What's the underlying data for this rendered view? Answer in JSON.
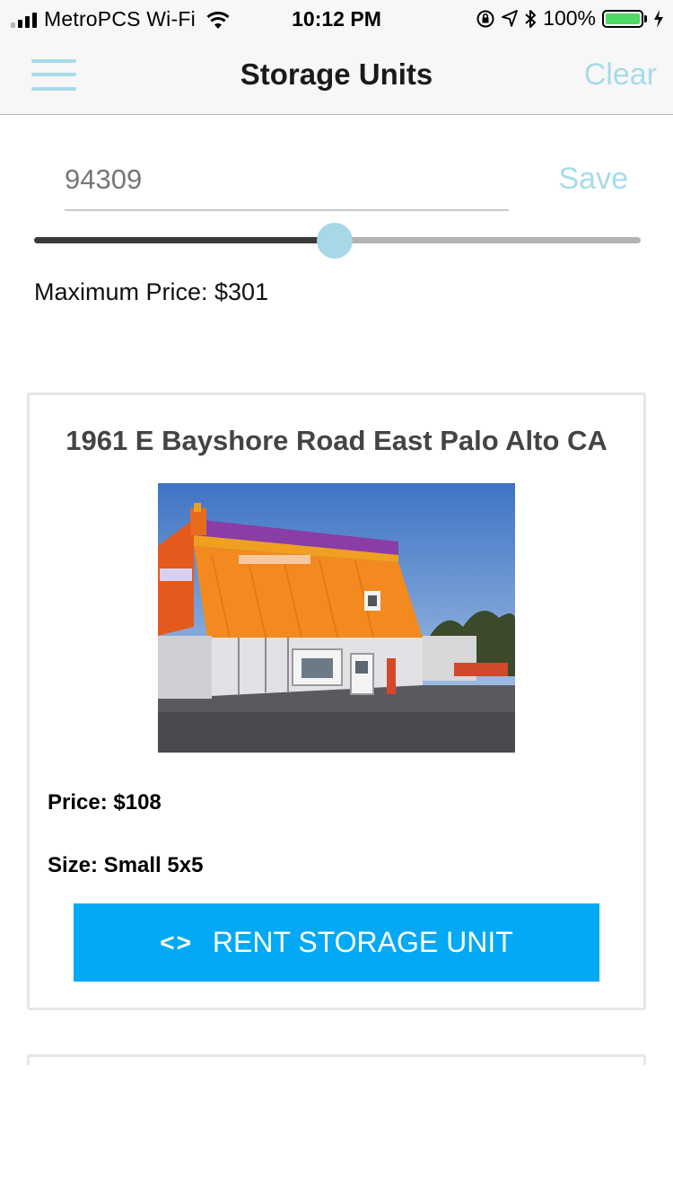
{
  "status_bar": {
    "carrier": "MetroPCS Wi-Fi",
    "time": "10:12 PM",
    "battery_percent": "100%",
    "signal_bars": 4,
    "signal_bars_active": 3,
    "icons": [
      "wifi-icon",
      "orientation-lock-icon",
      "location-arrow-icon",
      "bluetooth-icon",
      "battery-icon",
      "charging-bolt-icon"
    ]
  },
  "nav": {
    "title": "Storage Units",
    "clear_label": "Clear",
    "menu_icon": "hamburger-menu-icon"
  },
  "search": {
    "zip_value": "94309",
    "save_label": "Save"
  },
  "price_slider": {
    "fraction": 0.496,
    "max_price_text": "Maximum Price: $301"
  },
  "listings": [
    {
      "address": "1961 E Bayshore Road East Palo Alto CA",
      "price_text": "Price: $108",
      "size_text": "Size: Small 5x5",
      "rent_label": "RENT STORAGE UNIT",
      "rent_icon": "code-brackets-icon"
    }
  ],
  "colors": {
    "accent_light": "#a7dbe8",
    "button_blue": "#03a9f4",
    "battery_green": "#4cd964"
  }
}
